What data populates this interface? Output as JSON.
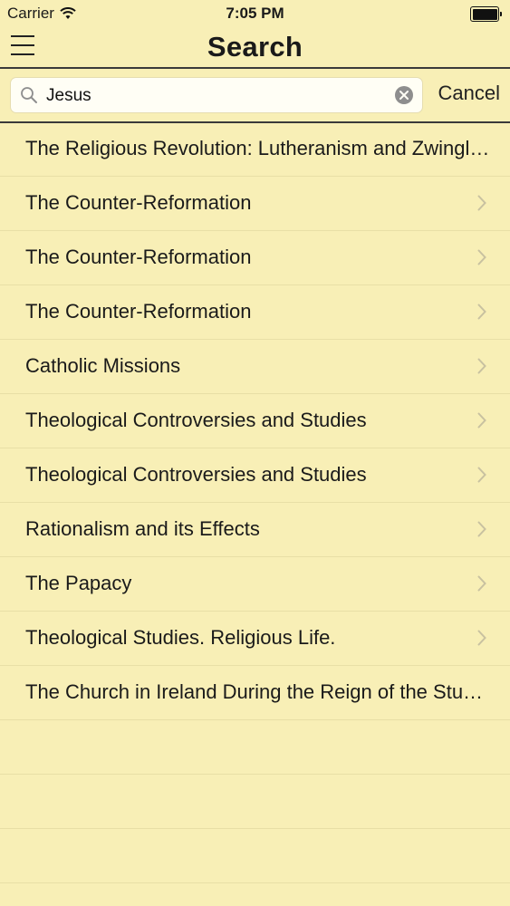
{
  "status": {
    "carrier": "Carrier",
    "time": "7:05 PM"
  },
  "nav": {
    "title": "Search",
    "menu_icon": "hamburger-menu-icon"
  },
  "search": {
    "value": "Jesus",
    "placeholder": "",
    "cancel_label": "Cancel"
  },
  "results": [
    "The Religious Revolution: Lutheranism and Zwingl…",
    "The Counter-Reformation",
    "The Counter-Reformation",
    "The Counter-Reformation",
    "Catholic Missions",
    "Theological Controversies and Studies",
    "Theological Controversies and Studies",
    "Rationalism and its Effects",
    "The Papacy",
    "Theological Studies. Religious Life.",
    "The Church in Ireland During the Reign of the Stu…"
  ],
  "colors": {
    "background": "#f8efb6",
    "separator": "#e8dfa6",
    "chevron": "#c8c1a0"
  }
}
